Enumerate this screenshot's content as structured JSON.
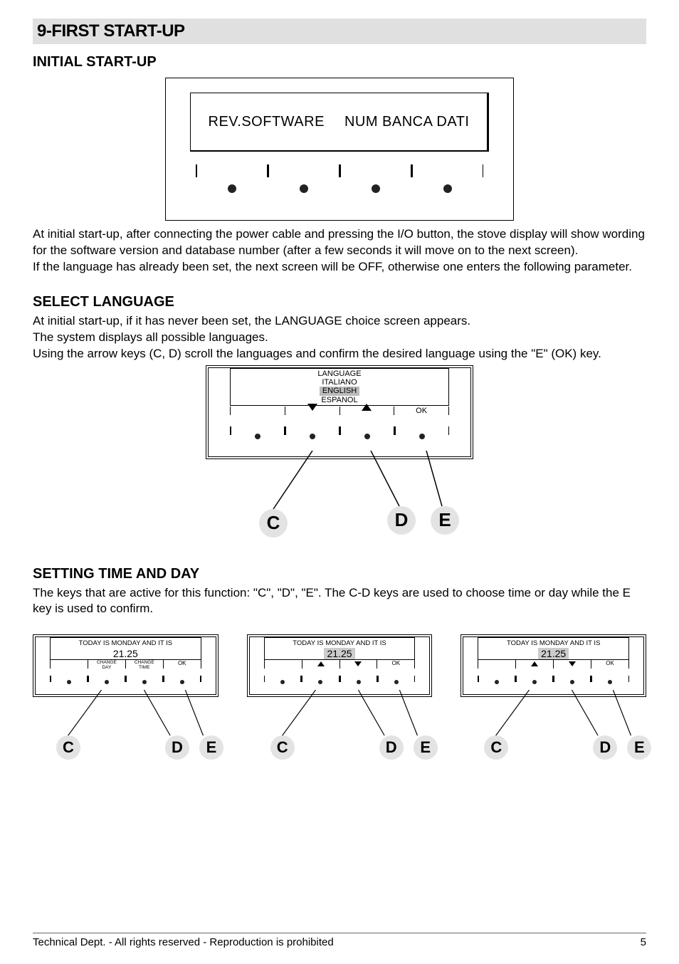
{
  "section_number": "9",
  "section_title": "9-FIRST START-UP",
  "initial": {
    "heading": "INITIAL START-UP",
    "screen_left": "REV.SOFTWARE",
    "screen_right": "NUM BANCA DATI",
    "para1": "At initial start-up, after connecting the power cable and pressing the I/O button, the stove display will show wording for the software version and database number (after a few seconds it will move on to the next screen).",
    "para2": "If the language has already been set, the next screen will be OFF, otherwise one enters the following parameter."
  },
  "lang": {
    "heading": "SELECT LANGUAGE",
    "para1": "At initial start-up, if it has never been set, the LANGUAGE choice screen appears.",
    "para2": "The system displays all possible languages.",
    "para3": "Using the arrow keys (C, D) scroll the languages and confirm the desired language using the \"E\" (OK) key.",
    "screen_title": "LANGUAGE",
    "opt1": "ITALIANO",
    "opt2": "ENGLISH",
    "opt3": "ESPANOL",
    "ok": "OK",
    "keyC": "C",
    "keyD": "D",
    "keyE": "E"
  },
  "time": {
    "heading": "SETTING TIME AND DAY",
    "para": "The keys that are active for this function: \"C\", \"D\", \"E\". The C-D keys are used to choose time or day while the E key is used to confirm.",
    "tline": "TODAY IS MONDAY AND IT IS",
    "num": "21.25",
    "changeDay": "CHANGE DAY",
    "changeTime": "CHANGE TIME",
    "ok": "OK",
    "keyC": "C",
    "keyD": "D",
    "keyE": "E"
  },
  "footer": {
    "left": "Technical Dept. - All rights reserved - Reproduction is prohibited",
    "right": "5"
  }
}
